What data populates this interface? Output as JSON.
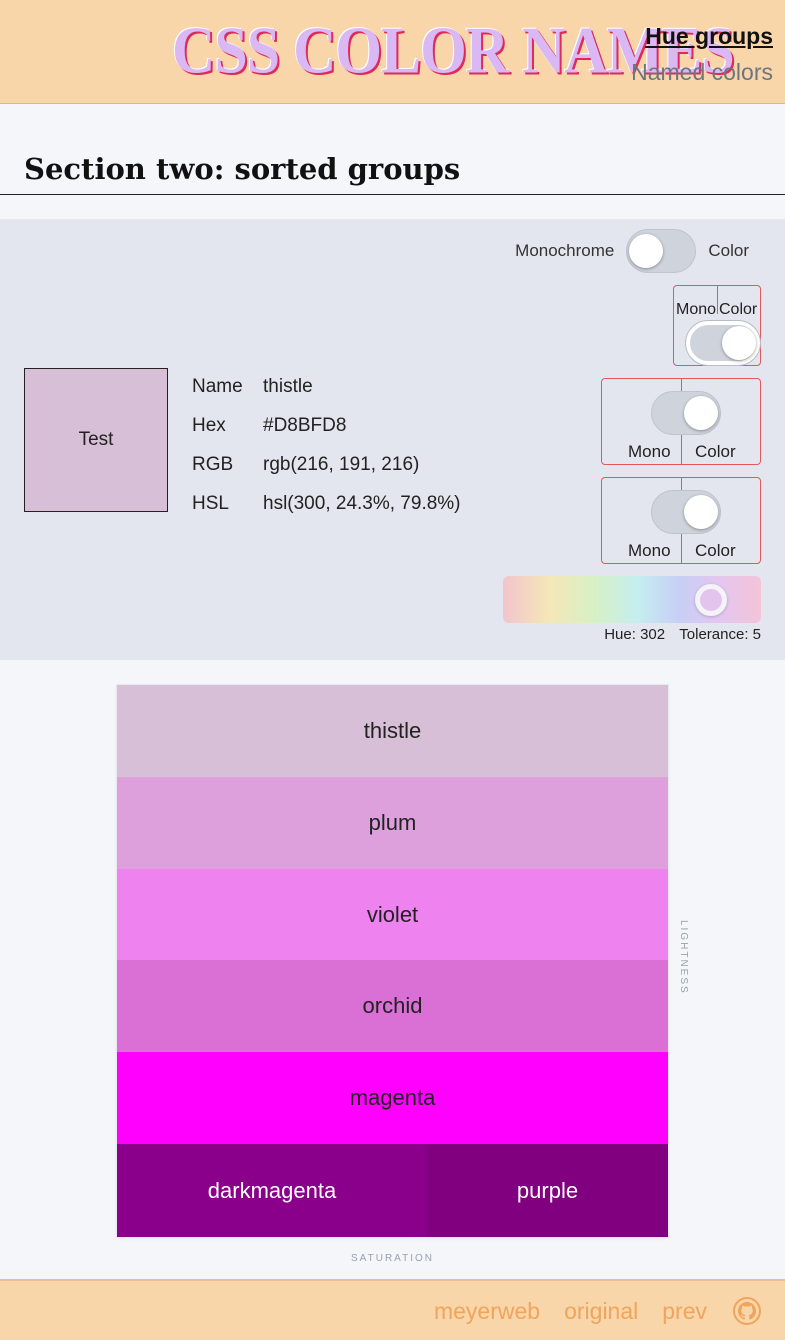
{
  "header": {
    "logo": "CSS COLOR NAMES",
    "nav": [
      {
        "label": "Hue groups",
        "current": true
      },
      {
        "label": "Named colors",
        "current": false
      }
    ]
  },
  "section": {
    "title": "Section two: sorted groups"
  },
  "controls": {
    "mode_toggle": {
      "left_label": "Monochrome",
      "right_label": "Color",
      "state": "Monochrome"
    },
    "toggle_2": {
      "left_label": "Mono",
      "right_label": "Color",
      "state": "Color"
    },
    "toggle_3": {
      "left_label": "Mono",
      "right_label": "Color",
      "state": "Color"
    },
    "toggle_4": {
      "left_label": "Mono",
      "right_label": "Color",
      "state": "Color"
    },
    "hue_label": "Hue: 302",
    "tolerance_label": "Tolerance: 5",
    "hue_value": 302
  },
  "preview": {
    "swatch_text": "Test",
    "swatch_color": "#D8BFD8",
    "rows": [
      {
        "key": "Name",
        "value": "thistle"
      },
      {
        "key": "Hex",
        "value": "#D8BFD8"
      },
      {
        "key": "RGB",
        "value": "rgb(216, 191, 216)"
      },
      {
        "key": "HSL",
        "value": "hsl(300, 24.3%, 79.8%)"
      }
    ]
  },
  "chart": {
    "y_axis_label": "LIGHTNESS",
    "x_axis_label": "SATURATION",
    "bands": [
      {
        "name": "thistle",
        "color": "#D8BFD8",
        "text_color": "#222222"
      },
      {
        "name": "plum",
        "color": "#DDA0DD",
        "text_color": "#222222"
      },
      {
        "name": "violet",
        "color": "#EE82EE",
        "text_color": "#222222"
      },
      {
        "name": "orchid",
        "color": "#DA70D6",
        "text_color": "#222222"
      },
      {
        "name": "magenta",
        "color": "#FF00FF",
        "text_color": "#222222"
      }
    ],
    "bottom_row": [
      {
        "name": "darkmagenta",
        "color": "#8B008B",
        "text_color": "#FFFFFF"
      },
      {
        "name": "purple",
        "color": "#800080",
        "text_color": "#FFFFFF"
      }
    ]
  },
  "footer": {
    "links": [
      "meyerweb",
      "original",
      "prev"
    ],
    "icon": "github-icon"
  }
}
